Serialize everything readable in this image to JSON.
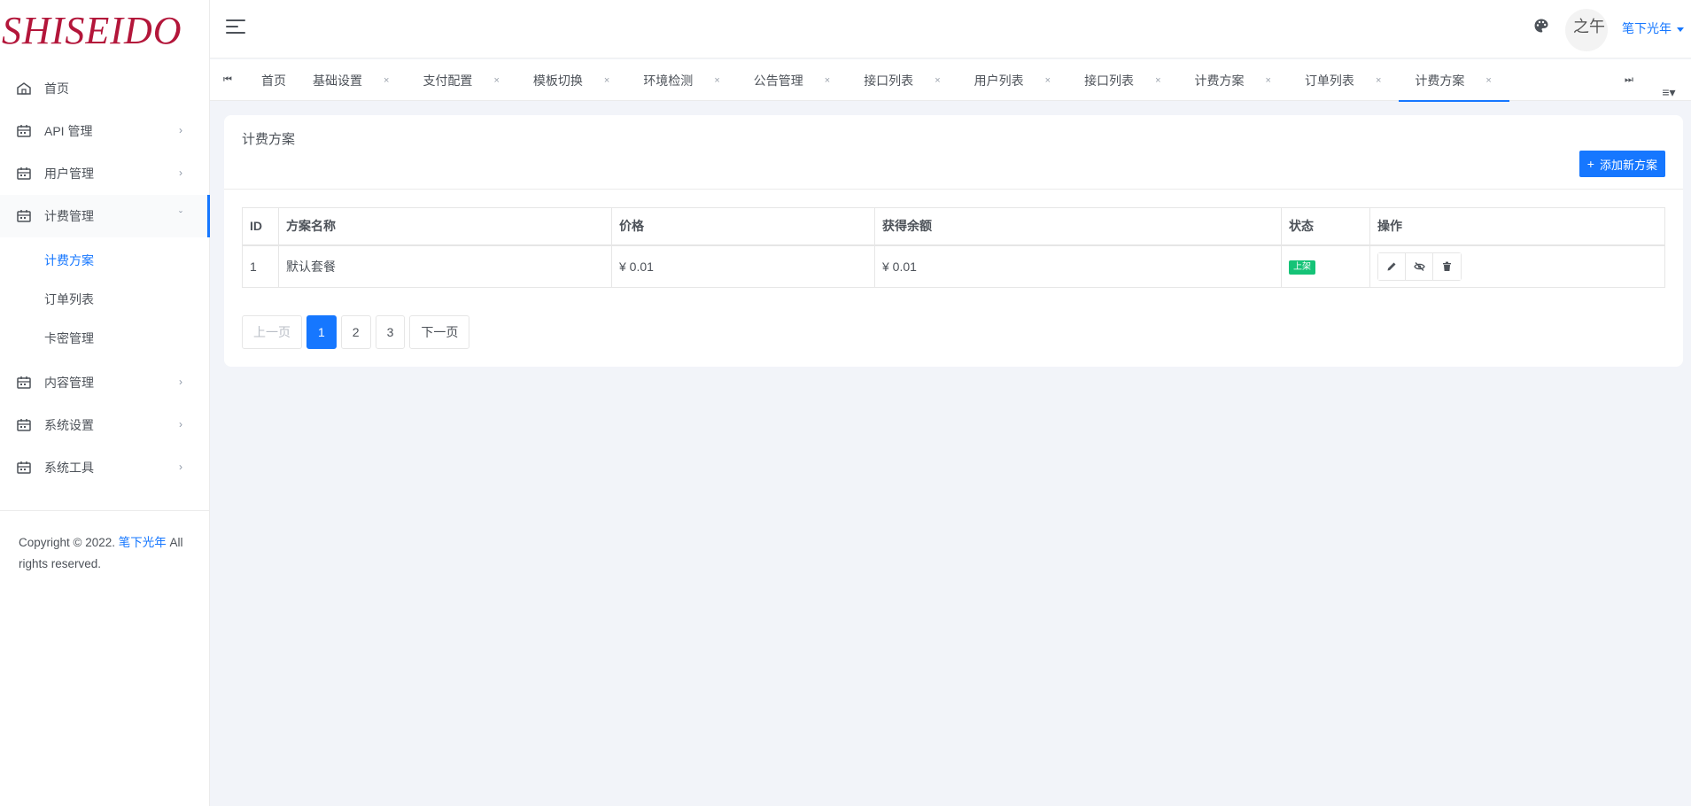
{
  "brand": {
    "logo_text": "SHISEIDO",
    "logo_color": "#b3163a"
  },
  "colors": {
    "accent": "#1677ff",
    "status_on": "#15c377"
  },
  "sidebar": {
    "items": [
      {
        "label": "首页",
        "icon": "home-icon"
      },
      {
        "label": "API 管理",
        "icon": "calendar-icon"
      },
      {
        "label": "用户管理",
        "icon": "calendar-icon"
      },
      {
        "label": "计费管理",
        "icon": "calendar-icon",
        "open": true,
        "children": [
          {
            "label": "计费方案",
            "active": true
          },
          {
            "label": "订单列表"
          },
          {
            "label": "卡密管理"
          }
        ]
      },
      {
        "label": "内容管理",
        "icon": "calendar-icon"
      },
      {
        "label": "系统设置",
        "icon": "calendar-icon"
      },
      {
        "label": "系统工具",
        "icon": "calendar-icon"
      }
    ],
    "copyright_prefix": "Copyright © 2022. ",
    "copyright_brand": "笔下光年",
    "copyright_suffix": " All rights reserved."
  },
  "header": {
    "user_name": "笔下光年",
    "avatar_text": "之午"
  },
  "tabs": [
    {
      "label": "首页",
      "closable": false
    },
    {
      "label": "基础设置",
      "closable": true
    },
    {
      "label": "支付配置",
      "closable": true
    },
    {
      "label": "模板切换",
      "closable": true
    },
    {
      "label": "环境检测",
      "closable": true
    },
    {
      "label": "公告管理",
      "closable": true
    },
    {
      "label": "接口列表",
      "closable": true
    },
    {
      "label": "用户列表",
      "closable": true
    },
    {
      "label": "接口列表",
      "closable": true
    },
    {
      "label": "计费方案",
      "closable": true
    },
    {
      "label": "订单列表",
      "closable": true
    },
    {
      "label": "计费方案",
      "closable": true,
      "active": true
    }
  ],
  "tab_close_glyph": "×",
  "card": {
    "title": "计费方案",
    "add_button": "添加新方案"
  },
  "table": {
    "columns": [
      "ID",
      "方案名称",
      "价格",
      "获得余额",
      "状态",
      "操作"
    ],
    "rows": [
      {
        "id": "1",
        "name": "默认套餐",
        "price": "¥ 0.01",
        "balance": "¥ 0.01",
        "status": "上架"
      }
    ]
  },
  "pagination": {
    "prev": "上一页",
    "pages": [
      "1",
      "2",
      "3"
    ],
    "current": "1",
    "next": "下一页"
  }
}
